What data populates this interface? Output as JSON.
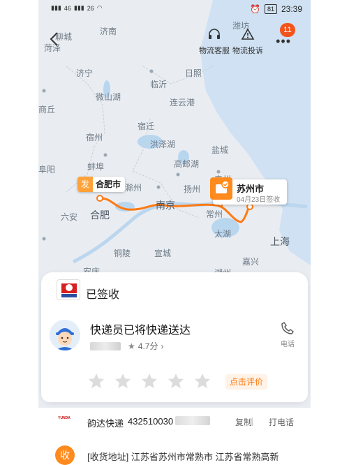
{
  "status_bar": {
    "time": "23:39",
    "battery": "81",
    "signal_left": "46",
    "signal_right": "26"
  },
  "top_actions": {
    "service_label": "物流客服",
    "complaint_label": "物流投诉",
    "badge_count": "11"
  },
  "map": {
    "labels": [
      {
        "id": "jinan",
        "text": "济南",
        "big": false
      },
      {
        "id": "weifang",
        "text": "潍坊",
        "big": false
      },
      {
        "id": "linyi",
        "text": "临沂",
        "big": false
      },
      {
        "id": "rizhao",
        "text": "日照",
        "big": false
      },
      {
        "id": "jining",
        "text": "济宁",
        "big": false
      },
      {
        "id": "weishanhu",
        "text": "微山湖",
        "big": false
      },
      {
        "id": "lianyungang",
        "text": "连云港",
        "big": false
      },
      {
        "id": "shangqiu",
        "text": "商丘",
        "big": false
      },
      {
        "id": "suqian",
        "text": "宿迁",
        "big": false
      },
      {
        "id": "suzhou_ah",
        "text": "宿州",
        "big": false
      },
      {
        "id": "hongzehu",
        "text": "洪泽湖",
        "big": false
      },
      {
        "id": "yancheng",
        "text": "盐城",
        "big": false
      },
      {
        "id": "bengbu",
        "text": "蚌埠",
        "big": false
      },
      {
        "id": "gaoyouhu",
        "text": "高邮湖",
        "big": false
      },
      {
        "id": "fuyang",
        "text": "阜阳",
        "big": false
      },
      {
        "id": "chuzhou",
        "text": "滁州",
        "big": false
      },
      {
        "id": "yangzhou",
        "text": "扬州",
        "big": false
      },
      {
        "id": "taizhou",
        "text": "泰州",
        "big": false
      },
      {
        "id": "nanjing",
        "text": "南京",
        "big": true
      },
      {
        "id": "changzhou",
        "text": "常州",
        "big": false
      },
      {
        "id": "liuan",
        "text": "六安",
        "big": false
      },
      {
        "id": "hefei",
        "text": "合肥",
        "big": true
      },
      {
        "id": "taihu",
        "text": "太湖",
        "big": false
      },
      {
        "id": "shanghai",
        "text": "上海",
        "big": true
      },
      {
        "id": "tongling",
        "text": "铜陵",
        "big": false
      },
      {
        "id": "xuancheng",
        "text": "宣城",
        "big": false
      },
      {
        "id": "jiaxing",
        "text": "嘉兴",
        "big": false
      },
      {
        "id": "anqing",
        "text": "安庆",
        "big": false
      },
      {
        "id": "huzhou",
        "text": "湖州",
        "big": false
      },
      {
        "id": "liaocheng",
        "text": "聊城",
        "big": false
      },
      {
        "id": "heze",
        "text": "菏泽",
        "big": false
      }
    ],
    "from": {
      "tag": "发",
      "city": "合肥市"
    },
    "to": {
      "city": "苏州市",
      "date": "04月23日签收"
    }
  },
  "card": {
    "status": "已签收",
    "message": "快递员已将快递送达",
    "rating": "4.7分",
    "phone_label": "电话",
    "rate_button": "点击评价",
    "star_count": 5
  },
  "row2": {
    "logo_text": "YUNDA",
    "courier": "韵达快递",
    "tracking": "432510030",
    "copy": "复制",
    "call": "打电话"
  },
  "row3": {
    "badge": "收",
    "address": "[收货地址] 江苏省苏州市常熟市 江苏省常熟高新"
  },
  "colors": {
    "accent": "#ff7a12",
    "route": "#ff7a12",
    "badge": "#f3541c"
  }
}
